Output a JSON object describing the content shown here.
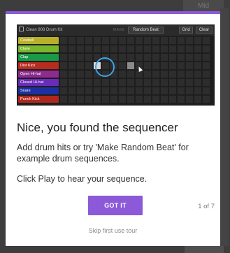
{
  "background": {
    "top_button_label": "Mid"
  },
  "preview": {
    "kit_name": "Clean 808 Drum Kit",
    "make_label": "MAKE",
    "random_beat_label": "Random Beat",
    "grid_label": "Grid",
    "clear_label": "Clear",
    "tracks": [
      {
        "label": "Cowbell",
        "color": "#b8b02b"
      },
      {
        "label": "Clave",
        "color": "#78b82b"
      },
      {
        "label": "Clap",
        "color": "#1a9a47"
      },
      {
        "label": "Dist Kick",
        "color": "#b82b1f"
      },
      {
        "label": "Open Hi-hat",
        "color": "#8e2b8e"
      },
      {
        "label": "Closed Hi-hat",
        "color": "#6a2bb8"
      },
      {
        "label": "Snare",
        "color": "#1e2fa3"
      },
      {
        "label": "Punch Kick",
        "color": "#b0281c"
      }
    ]
  },
  "tour": {
    "title": "Nice, you found the sequencer",
    "body_line1": "Add drum hits or try 'Make Random Beat' for example drum sequences.",
    "body_line2": "Click Play to hear your sequence.",
    "got_it_label": "GOT IT",
    "step": "1 of 7",
    "skip_label": "Skip first use tour"
  },
  "colors": {
    "accent": "#8c59d9",
    "highlight_ring": "#3ba2e8"
  }
}
